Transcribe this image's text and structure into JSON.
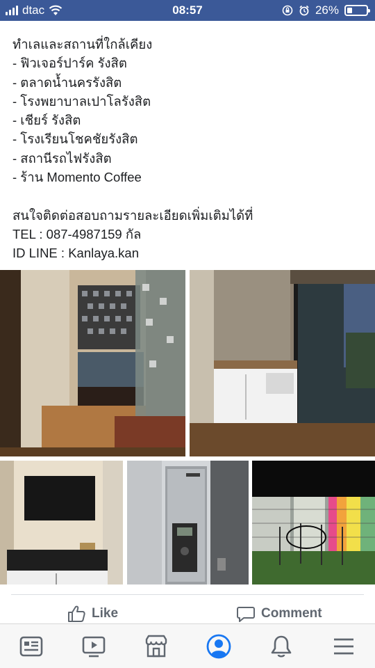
{
  "status_bar": {
    "carrier": "dtac",
    "time": "08:57",
    "battery": "26%",
    "battery_level": 0.26
  },
  "post": {
    "lines": [
      "ทำเลและสถานที่ใกล้เคียง",
      "- ฟิวเจอร์ปาร์ค รังสิต",
      "- ตลาดน้ำนครรังสิต",
      "- โรงพยาบาลเปาโลรังสิต",
      "- เชียร์ รังสิต",
      "- โรงเรียนโชคชัยรังสิต",
      "- สถานีรถไฟรังสิต",
      "- ร้าน Momento Coffee",
      "",
      "สนใจติดต่อสอบถามรายละเอียดเพิ่มเติมได้ที่",
      "TEL : 087-4987159 กัล",
      "ID LINE : Kanlaya.kan"
    ]
  },
  "actions": {
    "like_label": "Like",
    "comment_label": "Comment"
  },
  "tab_bar": {
    "icons": [
      "news-feed-icon",
      "watch-video-icon",
      "marketplace-icon",
      "profile-icon",
      "notifications-icon",
      "menu-icon"
    ],
    "active": "profile-icon"
  },
  "colors": {
    "status_bar": "#3b5998",
    "active_tab": "#1877f2",
    "inactive_tab": "#606770"
  }
}
